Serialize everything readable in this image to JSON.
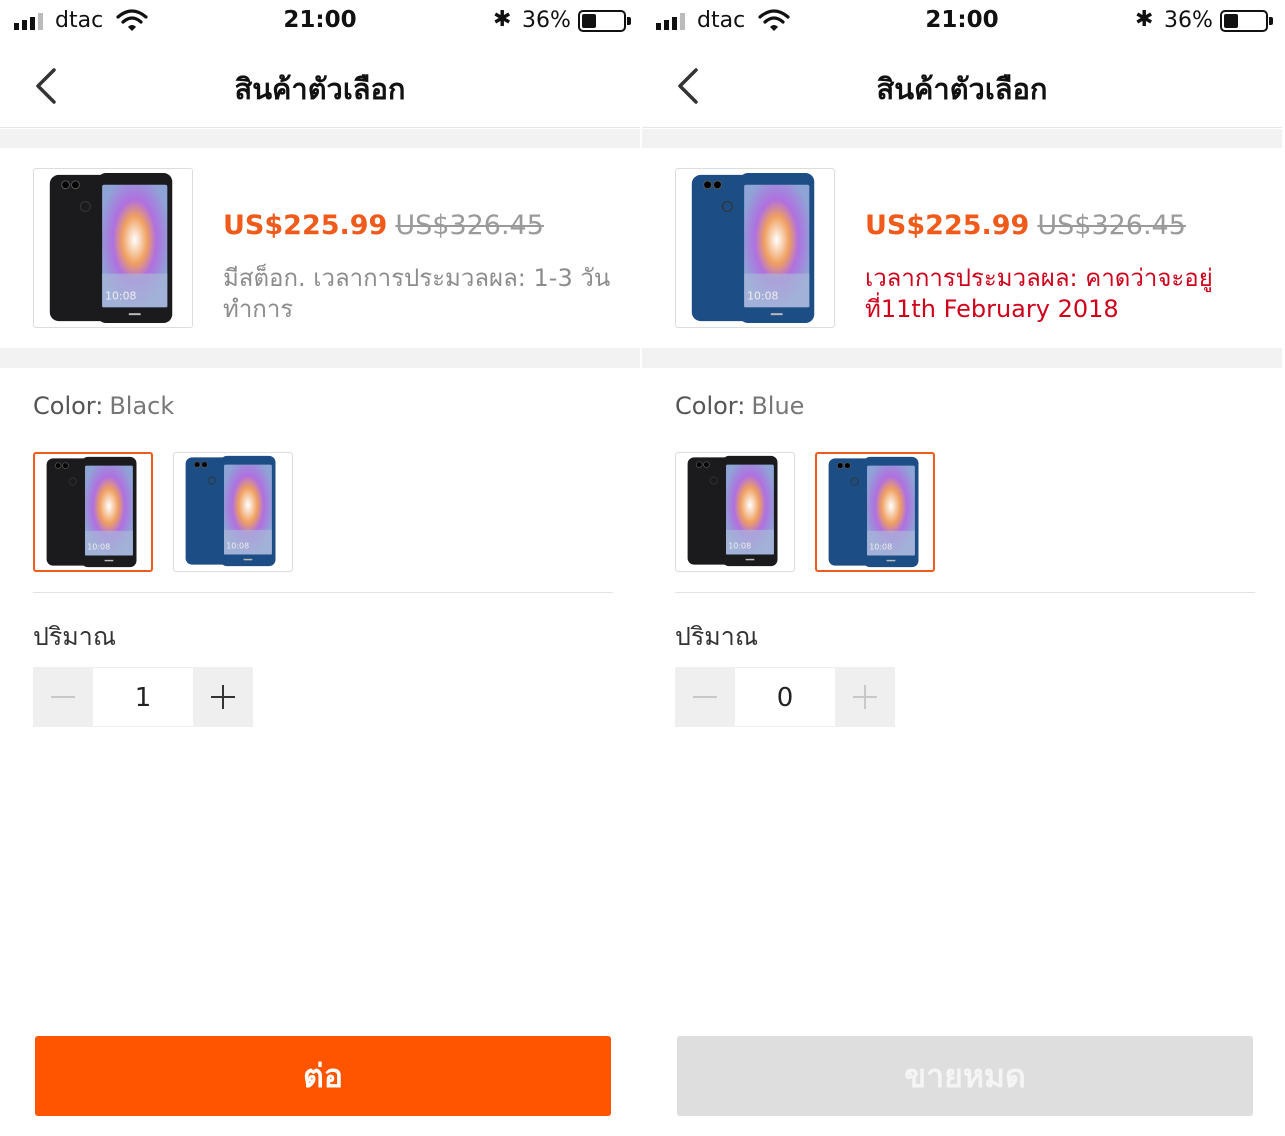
{
  "colors": {
    "accent": "#ff5500",
    "price": "#f05a1a",
    "alert": "#d0021b",
    "phone_black": "#1b1b1d",
    "phone_blue": "#1c4d85",
    "disabled_button": "#dedede"
  },
  "screens": [
    {
      "status": {
        "carrier": "dtac",
        "time": "21:00",
        "battery": "36%",
        "battery_level": 0.36
      },
      "nav": {
        "title": "สินค้าตัวเลือก",
        "back_icon": "chevron-left-icon"
      },
      "product": {
        "price": "US$225.99",
        "original_price": "US$326.45",
        "stock_text": "มีสต็อก. เวลาการประมวลผล: 1-3 วันทำการ",
        "stock_alert": false,
        "thumb_color": "black"
      },
      "color": {
        "label": "Color:",
        "value": "Black",
        "swatches": [
          "black",
          "blue"
        ],
        "selected": 0
      },
      "quantity": {
        "label": "ปริมาณ",
        "value": "1",
        "minus_enabled": false,
        "plus_enabled": true
      },
      "button": {
        "label": "ต่อ",
        "enabled": true
      }
    },
    {
      "status": {
        "carrier": "dtac",
        "time": "21:00",
        "battery": "36%",
        "battery_level": 0.36
      },
      "nav": {
        "title": "สินค้าตัวเลือก",
        "back_icon": "chevron-left-icon"
      },
      "product": {
        "price": "US$225.99",
        "original_price": "US$326.45",
        "stock_text": "เวลาการประมวลผล: คาดว่าจะอยู่ที่11th February 2018",
        "stock_alert": true,
        "thumb_color": "blue"
      },
      "color": {
        "label": "Color:",
        "value": "Blue",
        "swatches": [
          "black",
          "blue"
        ],
        "selected": 1
      },
      "quantity": {
        "label": "ปริมาณ",
        "value": "0",
        "minus_enabled": false,
        "plus_enabled": false
      },
      "button": {
        "label": "ขายหมด",
        "enabled": false
      }
    }
  ]
}
